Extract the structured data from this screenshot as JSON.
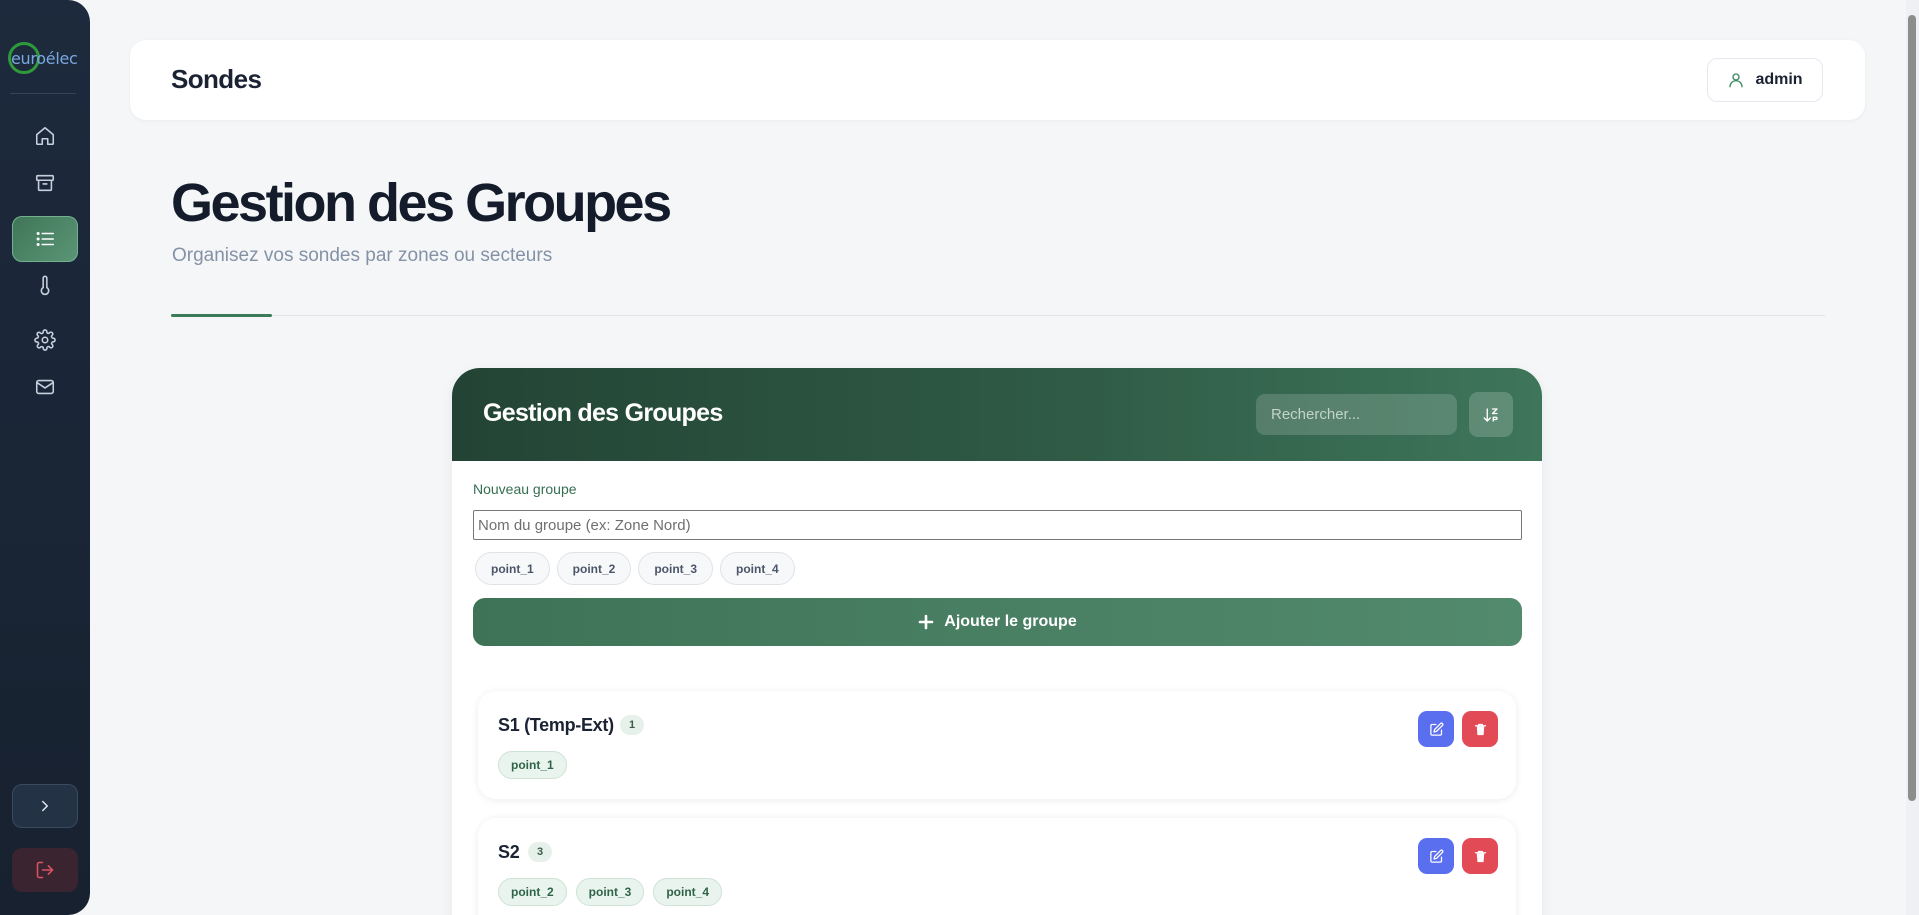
{
  "sidebar": {
    "logo_text": "euroélec",
    "nav_items": [
      {
        "icon": "home-icon"
      },
      {
        "icon": "archive-icon"
      },
      {
        "icon": "list-icon",
        "active": true
      },
      {
        "icon": "thermometer-icon"
      },
      {
        "icon": "gear-icon"
      },
      {
        "icon": "mail-icon"
      }
    ],
    "expand_icon": "chevron-right-icon",
    "logout_icon": "logout-icon"
  },
  "header": {
    "title": "Sondes",
    "user_label": "admin"
  },
  "page": {
    "title": "Gestion des Groupes",
    "subtitle": "Organisez vos sondes par zones ou secteurs"
  },
  "card": {
    "title": "Gestion des Groupes",
    "search_placeholder": "Rechercher...",
    "new_group_label": "Nouveau groupe",
    "name_placeholder": "Nom du groupe (ex: Zone Nord)",
    "point_chips": [
      "point_1",
      "point_2",
      "point_3",
      "point_4"
    ],
    "add_button_label": "Ajouter le groupe"
  },
  "groups": [
    {
      "name": "S1 (Temp-Ext)",
      "count": "1",
      "points": [
        "point_1"
      ]
    },
    {
      "name": "S2",
      "count": "3",
      "points": [
        "point_2",
        "point_3",
        "point_4"
      ]
    }
  ],
  "colors": {
    "accent_green": "#3d7a5a",
    "edit_blue": "#5a6ef0",
    "delete_red": "#e24a55",
    "sidebar_bg": "#1d2a3d"
  }
}
